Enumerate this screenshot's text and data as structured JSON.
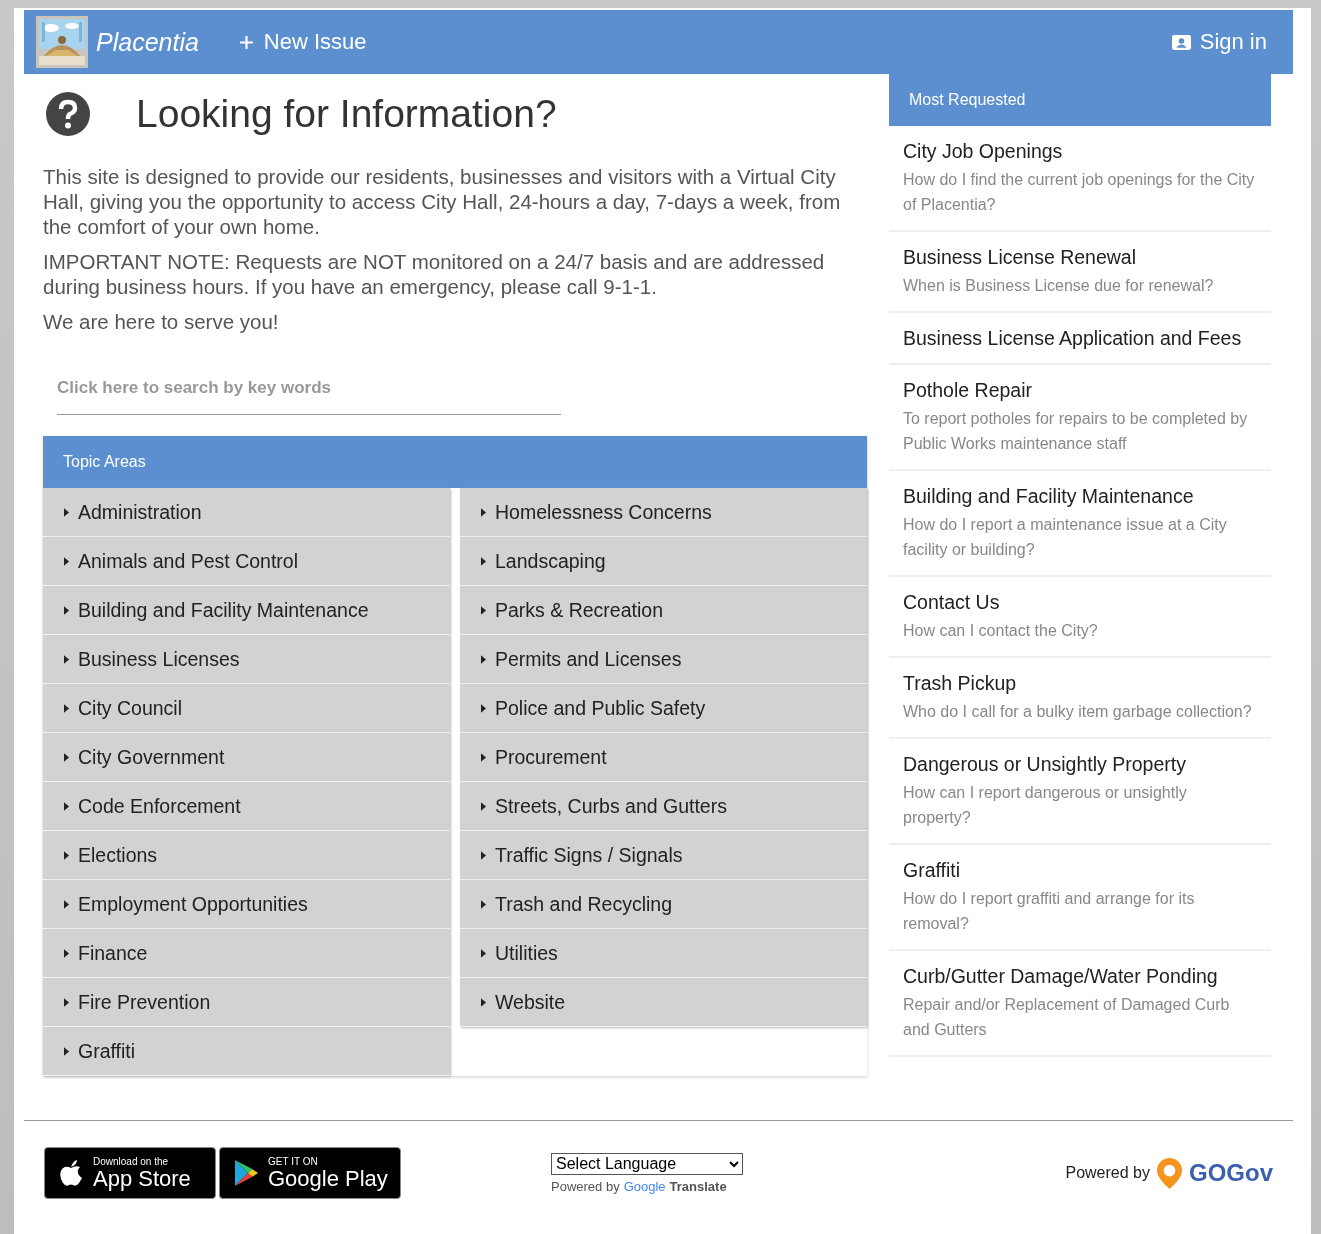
{
  "header": {
    "site_name": "Placentia",
    "new_issue": "New Issue",
    "sign_in": "Sign in"
  },
  "intro": {
    "title": "Looking for Information?",
    "paragraphs": [
      "This site is designed to provide our residents, businesses and visitors with a Virtual City Hall, giving you the opportunity to access City Hall, 24-hours a day, 7-days a week, from the comfort of your own home.",
      "IMPORTANT NOTE: Requests are NOT monitored on a 24/7 basis and are addressed during business hours. If you have an emergency, please call 9-1-1.",
      "We are here to serve you!"
    ]
  },
  "search": {
    "placeholder": "Click here to search by key words"
  },
  "topic_areas": {
    "title": "Topic Areas",
    "columns": [
      [
        "Administration",
        "Animals and Pest Control",
        "Building and Facility Maintenance",
        "Business Licenses",
        "City Council",
        "City Government",
        "Code Enforcement",
        "Elections",
        "Employment Opportunities",
        "Finance",
        "Fire Prevention",
        "Graffiti"
      ],
      [
        "Homelessness Concerns",
        "Landscaping",
        "Parks & Recreation",
        "Permits and Licenses",
        "Police and Public Safety",
        "Procurement",
        "Streets, Curbs and Gutters",
        "Traffic Signs / Signals",
        "Trash and Recycling",
        "Utilities",
        "Website"
      ]
    ]
  },
  "most_requested": {
    "title": "Most Requested",
    "items": [
      {
        "title": "City Job Openings",
        "description": "How do I find the current job openings for the City of Placentia?"
      },
      {
        "title": "Business License Renewal",
        "description": "When is Business License due for renewal?"
      },
      {
        "title": "Business License Application and Fees"
      },
      {
        "title": "Pothole Repair",
        "description": "To report potholes for repairs to be completed by Public Works maintenance staff"
      },
      {
        "title": "Building and Facility Maintenance",
        "description": "How do I report a maintenance issue at a City facility or building?"
      },
      {
        "title": "Contact Us",
        "description": "How can I contact the City?"
      },
      {
        "title": "Trash Pickup",
        "description": "Who do I call for a bulky item garbage collection?"
      },
      {
        "title": "Dangerous or Unsightly Property",
        "description": "How can I report dangerous or unsightly property?"
      },
      {
        "title": "Graffiti",
        "description": "How do I report graffiti and arrange for its removal?"
      },
      {
        "title": "Curb/Gutter Damage/Water Ponding",
        "description": "Repair and/or Replacement of Damaged Curb and Gutters"
      }
    ]
  },
  "footer": {
    "app_store": {
      "small": "Download on the",
      "big": "App Store"
    },
    "google_play": {
      "small": "GET IT ON",
      "big": "Google Play"
    },
    "language_select": "Select Language",
    "translate_powered": "Powered by",
    "translate_google": "Google",
    "translate_word": "Translate",
    "powered_by": "Powered by",
    "gogov": "GOGov"
  }
}
